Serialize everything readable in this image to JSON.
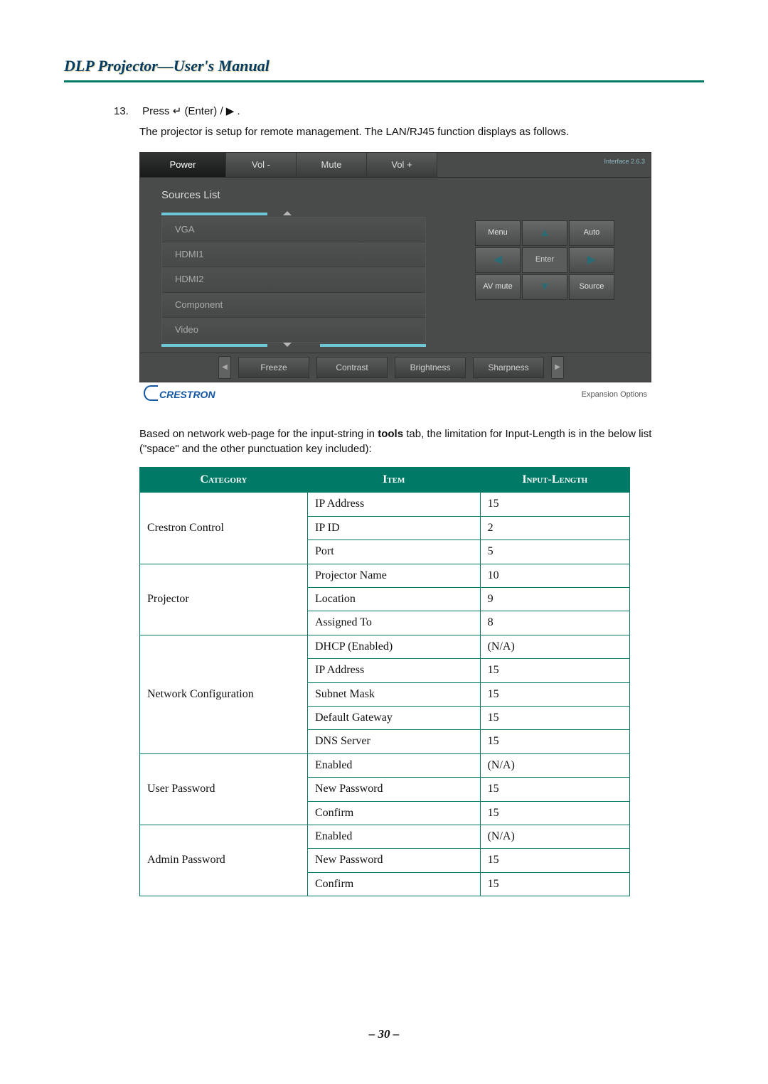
{
  "header_title": "DLP Projector—User's Manual",
  "step_number": "13.",
  "step_text_prefix": "Press ",
  "step_text_mid": " (Enter) / ",
  "step_text_suffix": ".",
  "sub_text": "The projector is setup for remote management. The LAN/RJ45 function displays as follows.",
  "panel": {
    "top_buttons": [
      "Power",
      "Vol -",
      "Mute",
      "Vol +"
    ],
    "interface_version": "Interface 2.6.3",
    "sources_title": "Sources List",
    "sources": [
      "VGA",
      "HDMI1",
      "HDMI2",
      "Component",
      "Video"
    ],
    "nav": {
      "menu": "Menu",
      "auto": "Auto",
      "enter": "Enter",
      "avmute": "AV mute",
      "source": "Source"
    },
    "bottom_buttons": [
      "Freeze",
      "Contrast",
      "Brightness",
      "Sharpness"
    ],
    "logo": "CRESTRON",
    "expansion": "Expansion Options"
  },
  "explain_before": "Based on network web-page for the input-string in ",
  "explain_bold": "tools",
  "explain_after": " tab, the limitation for Input-Length is in the below list (\"space\" and the other punctuation key included):",
  "table": {
    "headers": [
      "Category",
      "Item",
      "Input-Length"
    ],
    "categories": [
      {
        "name": "Crestron Control",
        "items": [
          {
            "item": "IP Address",
            "len": "15"
          },
          {
            "item": "IP ID",
            "len": "2"
          },
          {
            "item": "Port",
            "len": "5"
          }
        ]
      },
      {
        "name": "Projector",
        "items": [
          {
            "item": "Projector Name",
            "len": "10"
          },
          {
            "item": "Location",
            "len": "9"
          },
          {
            "item": "Assigned To",
            "len": "8"
          }
        ]
      },
      {
        "name": "Network Configuration",
        "items": [
          {
            "item": "DHCP (Enabled)",
            "len": "(N/A)"
          },
          {
            "item": "IP Address",
            "len": "15"
          },
          {
            "item": "Subnet Mask",
            "len": "15"
          },
          {
            "item": "Default Gateway",
            "len": "15"
          },
          {
            "item": "DNS Server",
            "len": "15"
          }
        ]
      },
      {
        "name": "User Password",
        "items": [
          {
            "item": "Enabled",
            "len": "(N/A)"
          },
          {
            "item": "New Password",
            "len": "15"
          },
          {
            "item": "Confirm",
            "len": "15"
          }
        ]
      },
      {
        "name": "Admin Password",
        "items": [
          {
            "item": "Enabled",
            "len": "(N/A)"
          },
          {
            "item": "New Password",
            "len": "15"
          },
          {
            "item": "Confirm",
            "len": "15"
          }
        ]
      }
    ]
  },
  "page_number": "– 30 –"
}
